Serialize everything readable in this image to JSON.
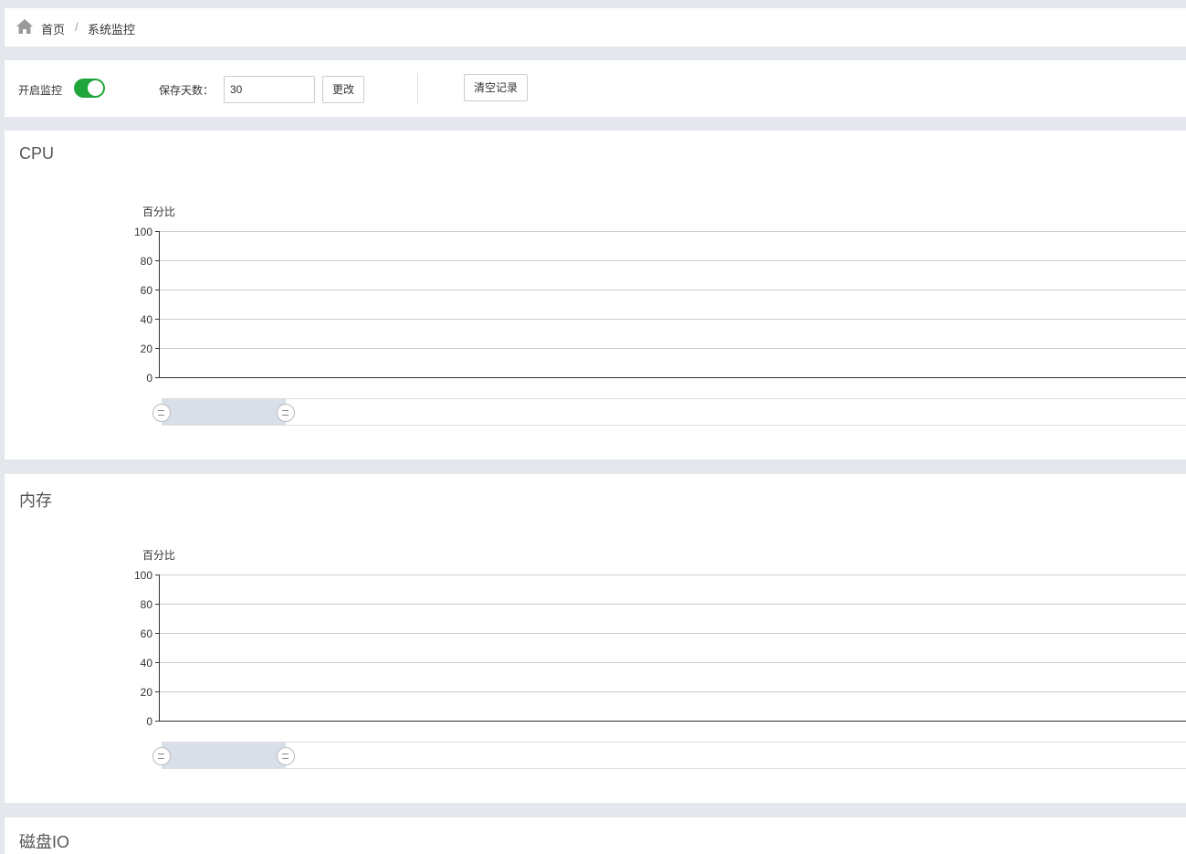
{
  "breadcrumb": {
    "home": "首页",
    "separator": "/",
    "current": "系统监控"
  },
  "toolbar": {
    "monitor_label": "开启监控",
    "monitor_enabled": true,
    "save_days_label": "保存天数：",
    "save_days_value": "30",
    "change_button": "更改",
    "clear_button": "清空记录"
  },
  "colors": {
    "accent": "#20a53a",
    "zoom_fill": "#d9dfe8",
    "background": "#e4e7ec"
  },
  "charts": {
    "cpu": {
      "title": "CPU",
      "ylabel": "百分比",
      "ticks": [
        "100",
        "80",
        "60",
        "40",
        "20",
        "0"
      ]
    },
    "mem": {
      "title": "内存",
      "ylabel": "百分比",
      "ticks": [
        "100",
        "80",
        "60",
        "40",
        "20",
        "0"
      ]
    },
    "disk": {
      "title": "磁盘IO"
    }
  },
  "chart_data": [
    {
      "type": "line",
      "title": "CPU",
      "ylabel": "百分比",
      "ylim": [
        0,
        100
      ],
      "yticks": [
        0,
        20,
        40,
        60,
        80,
        100
      ],
      "series": [],
      "grid": true
    },
    {
      "type": "line",
      "title": "内存",
      "ylabel": "百分比",
      "ylim": [
        0,
        100
      ],
      "yticks": [
        0,
        20,
        40,
        60,
        80,
        100
      ],
      "series": [],
      "grid": true
    }
  ]
}
